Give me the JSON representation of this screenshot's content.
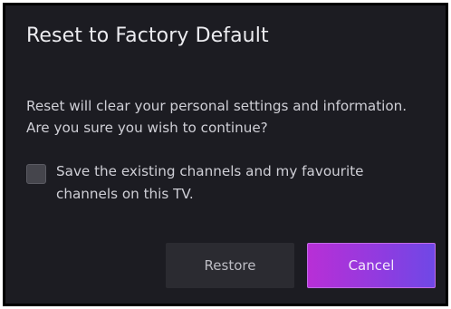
{
  "dialog": {
    "title": "Reset to Factory Default",
    "message_line1": "Reset will clear your personal settings and information.",
    "message_line2": "Are you sure you wish to continue?",
    "checkbox": {
      "label_line1": "Save the existing channels and my favourite",
      "label_line2": "channels on this TV.",
      "checked": false
    },
    "buttons": {
      "restore_label": "Restore",
      "cancel_label": "Cancel"
    }
  },
  "colors": {
    "background": "#1c1c22",
    "accent_start": "#b82fd6",
    "accent_end": "#6f48e6"
  }
}
